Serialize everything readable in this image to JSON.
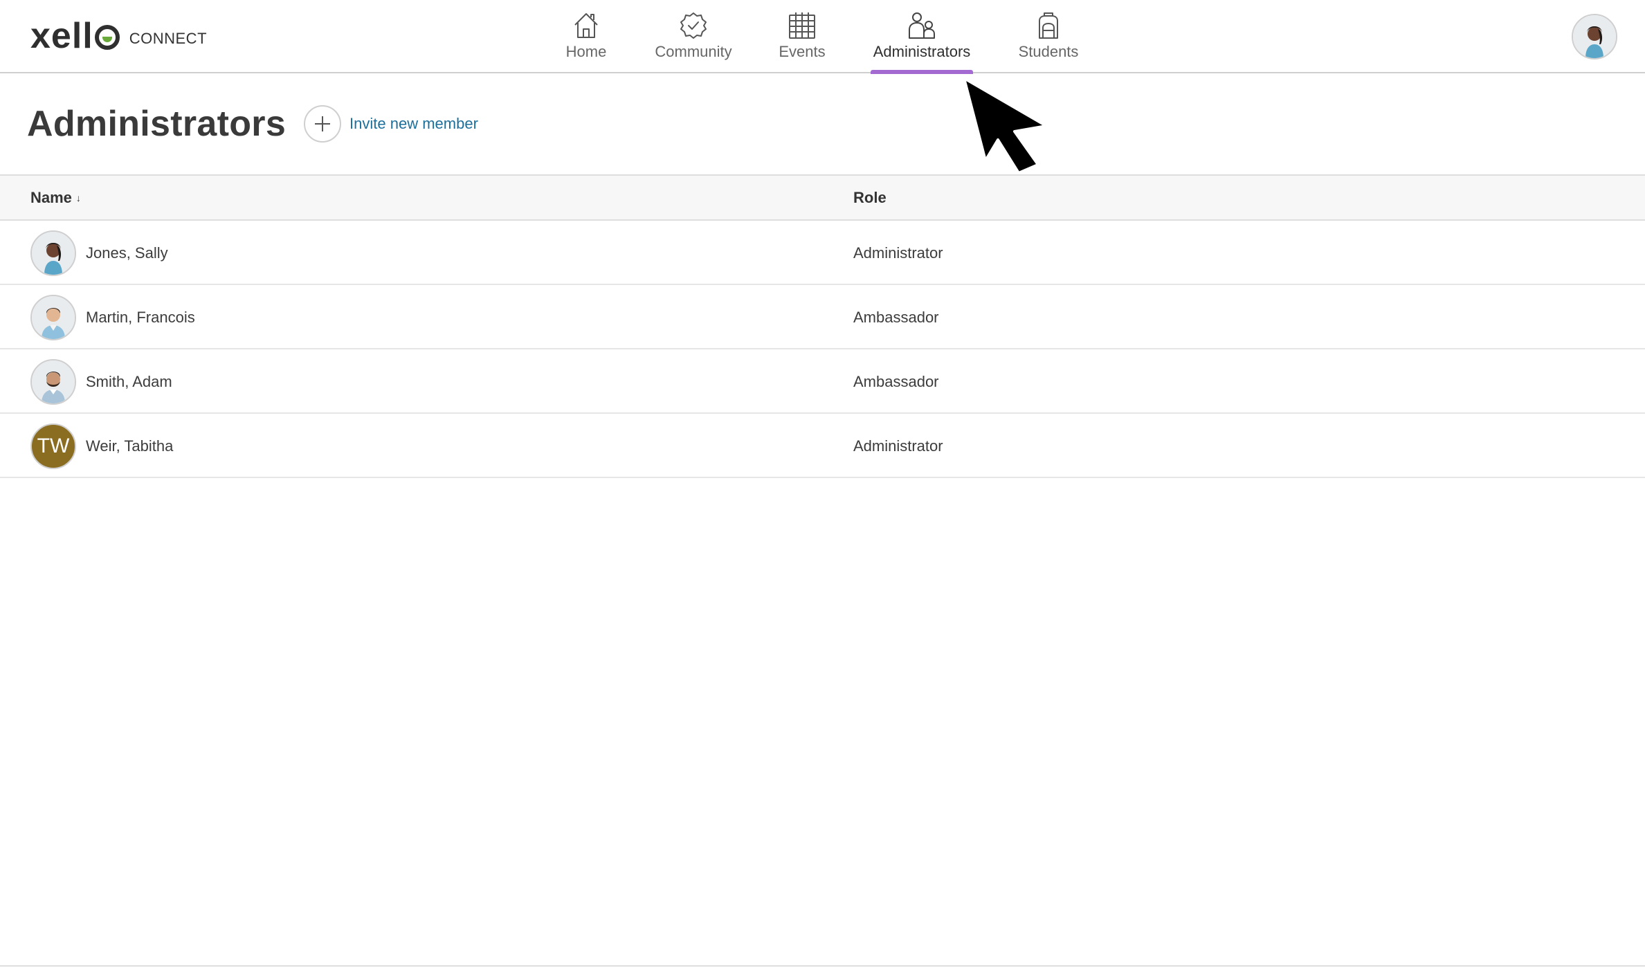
{
  "brand": {
    "logo_text": "xell",
    "product": "CONNECT"
  },
  "nav": {
    "items": [
      {
        "label": "Home",
        "icon": "home-icon",
        "active": false
      },
      {
        "label": "Community",
        "icon": "badge-check-icon",
        "active": false
      },
      {
        "label": "Events",
        "icon": "calendar-icon",
        "active": false
      },
      {
        "label": "Administrators",
        "icon": "people-icon",
        "active": true
      },
      {
        "label": "Students",
        "icon": "backpack-icon",
        "active": false
      }
    ],
    "active_color": "#a36ad1"
  },
  "page": {
    "title": "Administrators",
    "invite_label": "Invite new member"
  },
  "table": {
    "headers": {
      "name": "Name",
      "name_sort": "↓",
      "role": "Role"
    },
    "rows": [
      {
        "name": "Jones, Sally",
        "role": "Administrator",
        "avatar": "photo"
      },
      {
        "name": "Martin, Francois",
        "role": "Ambassador",
        "avatar": "photo"
      },
      {
        "name": "Smith, Adam",
        "role": "Ambassador",
        "avatar": "photo"
      },
      {
        "name": "Weir, Tabitha",
        "role": "Administrator",
        "avatar": "initials",
        "initials": "TW",
        "avatar_color": "#8a6d20"
      }
    ]
  },
  "colors": {
    "link": "#1d6f9c",
    "logo_accent": "#6aaa3a"
  }
}
